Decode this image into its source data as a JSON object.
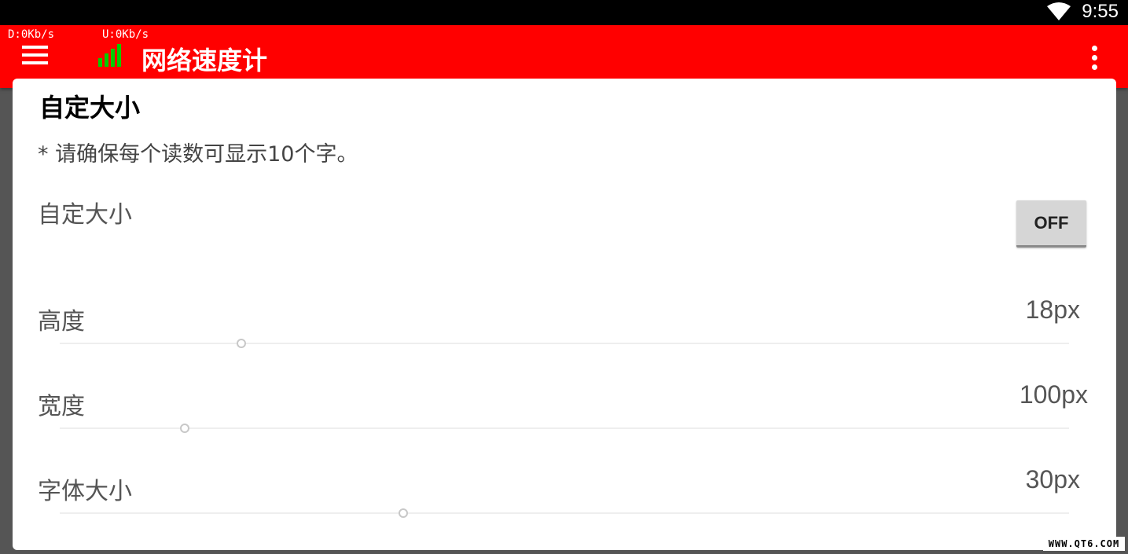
{
  "status_bar": {
    "time": "9:55",
    "wifi_icon": "wifi-icon"
  },
  "app_bar": {
    "download_speed": "D:0Kb/s",
    "upload_speed": "U:0Kb/s",
    "title": "网络速度计",
    "menu_icon": "menu-icon",
    "signal_icon": "signal-bars-icon",
    "overflow_icon": "more-vert-icon",
    "color": "#ff0000"
  },
  "card": {
    "section_title": "自定大小",
    "note": "* 请确保每个读数可显示10个字。",
    "custom_size": {
      "label": "自定大小",
      "toggle": "OFF"
    },
    "height": {
      "label": "高度",
      "value": "18px",
      "level": 0.18
    },
    "width": {
      "label": "宽度",
      "value": "100px",
      "level": 0.124
    },
    "font_size": {
      "label": "字体大小",
      "value": "30px",
      "level": 0.34
    }
  },
  "watermark": "WWW.QT6.COM"
}
